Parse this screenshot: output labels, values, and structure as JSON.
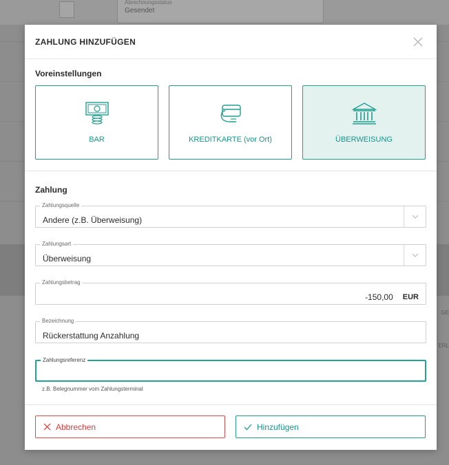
{
  "background": {
    "field_label": "Abrechnungsstatus",
    "field_value": "Gesendet",
    "edge_texts": [
      "GE",
      "ERL"
    ]
  },
  "modal": {
    "title": "ZAHLUNG HINZUFÜGEN",
    "presets": {
      "title": "Voreinstellungen",
      "tiles": [
        {
          "label": "BAR",
          "icon": "cash-icon",
          "selected": false
        },
        {
          "label": "KREDITKARTE (vor Ort)",
          "icon": "credit-card-icon",
          "selected": false
        },
        {
          "label": "ÜBERWEISUNG",
          "icon": "bank-icon",
          "selected": true
        }
      ]
    },
    "payment": {
      "title": "Zahlung",
      "fields": {
        "source": {
          "label": "Zahlungsquelle",
          "value": "Andere (z.B. Überweisung)"
        },
        "type": {
          "label": "Zahlungsart",
          "value": "Überweisung"
        },
        "amount": {
          "label": "Zahlungsbetrag",
          "value": "-150,00",
          "currency": "EUR"
        },
        "description": {
          "label": "Bezeichnung",
          "value": "Rückerstattung Anzahlung"
        },
        "reference": {
          "label": "Zahlungsreferenz",
          "value": "",
          "helper": "z.B. Belegnummer vom Zahlungsterminal"
        }
      }
    },
    "footer": {
      "cancel_label": "Abbrechen",
      "add_label": "Hinzufügen"
    }
  },
  "colors": {
    "accent": "#1f9e8e",
    "danger": "#d94a4a",
    "selected_bg": "#e3f1ef"
  }
}
